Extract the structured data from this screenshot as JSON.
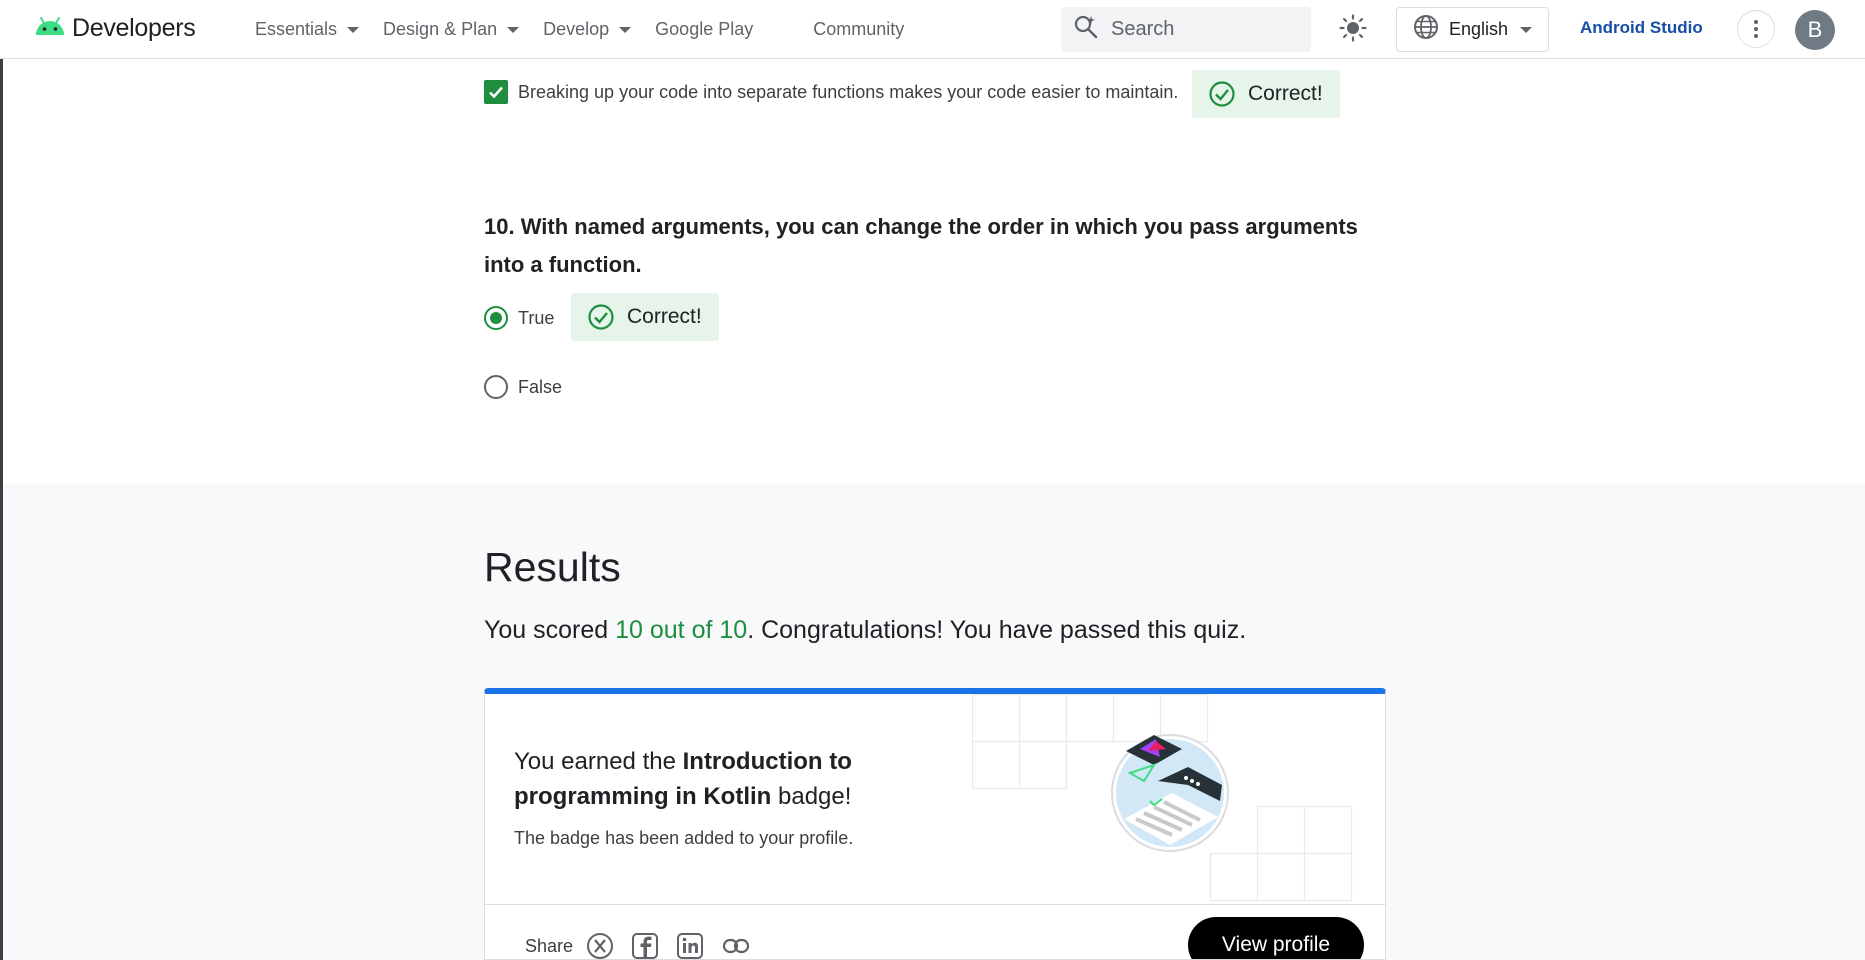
{
  "header": {
    "logo_text": "Developers",
    "nav": [
      {
        "label": "Essentials",
        "has_dropdown": true
      },
      {
        "label": "Design & Plan",
        "has_dropdown": true
      },
      {
        "label": "Develop",
        "has_dropdown": true
      },
      {
        "label": "Google Play",
        "has_dropdown": false
      },
      {
        "label": "Community",
        "has_dropdown": false
      }
    ],
    "search_placeholder": "Search",
    "language": "English",
    "studio_link": "Android Studio",
    "avatar_initial": "B"
  },
  "quiz": {
    "prev_answer": {
      "text": "Breaking up your code into separate functions makes your code easier to maintain.",
      "checked": true,
      "feedback": "Correct!"
    },
    "question": {
      "number": "10.",
      "text": "With named arguments, you can change the order in which you pass arguments into a function.",
      "options": [
        {
          "label": "True",
          "selected": true
        },
        {
          "label": "False",
          "selected": false
        }
      ],
      "feedback": "Correct!"
    }
  },
  "results": {
    "title": "Results",
    "score_prefix": "You scored ",
    "score_value": "10 out of 10",
    "score_suffix": ". Congratulations! You have passed this quiz.",
    "badge": {
      "earned_prefix": "You earned the ",
      "badge_name": "Introduction to programming in Kotlin",
      "earned_suffix": " badge!",
      "added_text": "The badge has been added to your profile.",
      "share_label": "Share",
      "view_profile": "View profile"
    }
  },
  "colors": {
    "accent": "#1a73e8",
    "success": "#1e8e3e",
    "success_bg": "#e6f4ea",
    "android_green": "#3ddc84"
  },
  "icons": [
    "android-icon",
    "search-icon",
    "sun-icon",
    "globe-icon",
    "more-vert-icon",
    "checkmark-icon",
    "x-icon",
    "facebook-icon",
    "linkedin-icon",
    "link-icon"
  ]
}
